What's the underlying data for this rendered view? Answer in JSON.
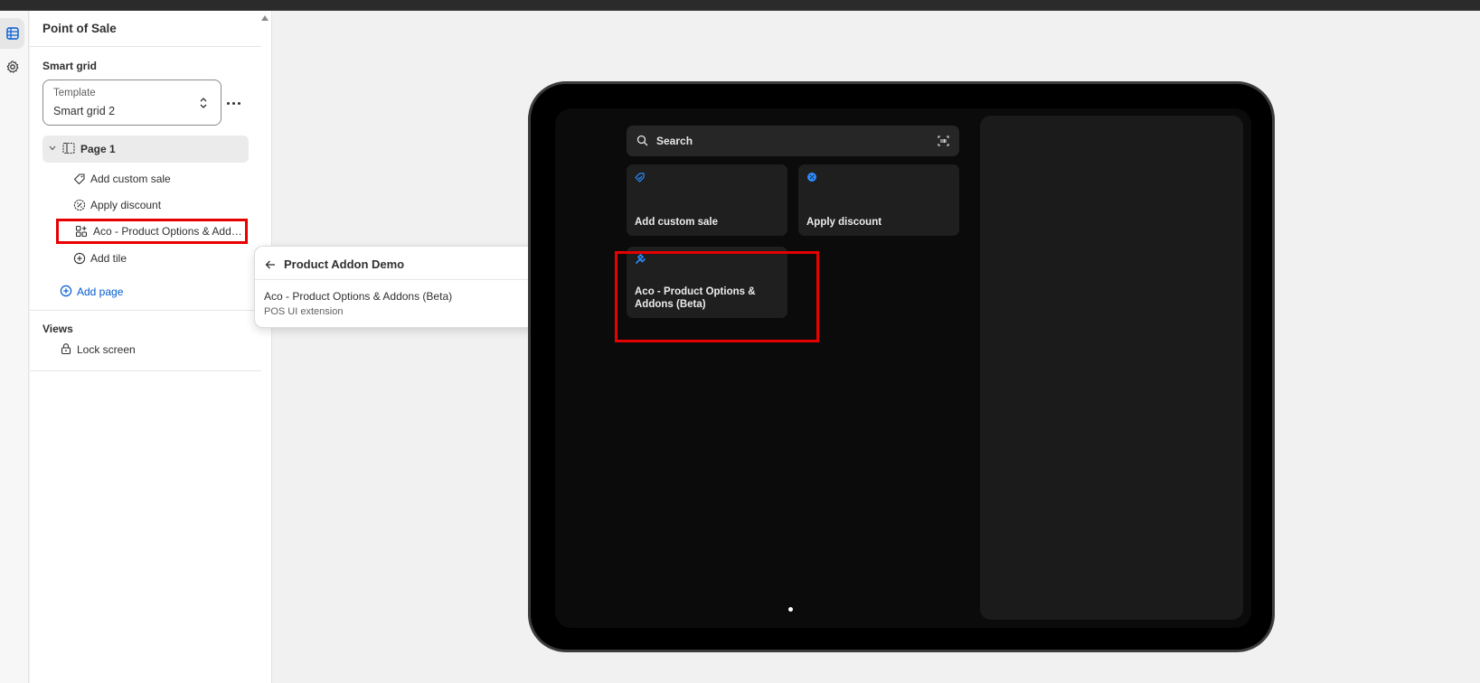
{
  "sidebar": {
    "title": "Point of Sale",
    "smart_grid_label": "Smart grid",
    "template_label": "Template",
    "template_value": "Smart grid 2",
    "page_label": "Page 1",
    "tiles": [
      {
        "label": "Add custom sale",
        "icon": "tag-icon"
      },
      {
        "label": "Apply discount",
        "icon": "discount-icon"
      },
      {
        "label": "Aco - Product Options & Addons (Beta)",
        "icon": "app-extension-icon"
      },
      {
        "label": "Add tile",
        "icon": "plus-circle-icon"
      }
    ],
    "add_page_label": "Add page",
    "views_label": "Views",
    "lock_screen_label": "Lock screen"
  },
  "popover": {
    "title": "Product Addon Demo",
    "item_name": "Aco - Product Options & Addons (Beta)",
    "item_sub": "POS UI extension"
  },
  "preview": {
    "search_placeholder": "Search",
    "tiles": [
      {
        "label": "Add custom sale"
      },
      {
        "label": "Apply discount"
      },
      {
        "label": "Aco - Product Options & Addons (Beta)"
      }
    ]
  },
  "colors": {
    "accent": "#005bd3",
    "highlight": "#e60000",
    "tile_icon": "#2b8cff"
  }
}
